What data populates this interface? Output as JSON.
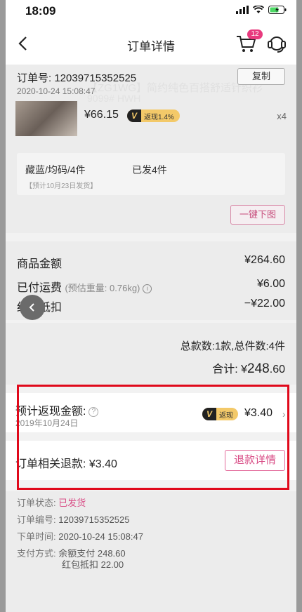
{
  "status_bar": {
    "time": "18:09"
  },
  "nav": {
    "title": "订单详情",
    "cart_count": "12"
  },
  "order": {
    "number_label": "订单号: 12039715352525",
    "time": "2020-10-24 15:08:47",
    "copy_label": "复制",
    "ghost_title": "【ZG1WG】简约纯色百搭舒适针织衫",
    "ghost_sub": "9099# HWH"
  },
  "product": {
    "price": "¥66.15",
    "rebate_tag": "返现1.4%",
    "qty": "x4",
    "spec": "藏蓝/均码/4件",
    "shipped": "已发4件",
    "ship_hint": "【预计10月23日发货】",
    "download_label": "一键下图"
  },
  "amounts": {
    "goods_label": "商品金额",
    "goods_value": "¥264.60",
    "freight_label": "已付运费",
    "freight_sub": "(预估重量: 0.76kg)",
    "freight_value": "¥6.00",
    "redpacket_label": "红包抵扣",
    "redpacket_value": "−¥22.00"
  },
  "totals": {
    "count": "总款数:1款,总件数:4件",
    "sum_label": "合计: ¥",
    "sum_big": "248",
    "sum_small": ".60"
  },
  "rebate": {
    "label": "预计返现金额:",
    "date": "2019年10月24日",
    "tag": "返现",
    "amount": "¥3.40"
  },
  "refund": {
    "label": "订单相关退款: ¥3.40",
    "button": "退款详情"
  },
  "info": {
    "status_key": "订单状态:",
    "status_value": "已发货",
    "no_key": "订单编号:",
    "no_value": "12039715352525",
    "time_key": "下单时间:",
    "time_value": "2020-10-24 15:08:47",
    "pay_key": "支付方式:",
    "pay_line1": "余额支付 248.60",
    "pay_line2": "红包抵扣 22.00"
  },
  "colors": {
    "accent": "#d94d86",
    "highlight": "#e0091b",
    "rebate_gold": "#f3c969"
  }
}
